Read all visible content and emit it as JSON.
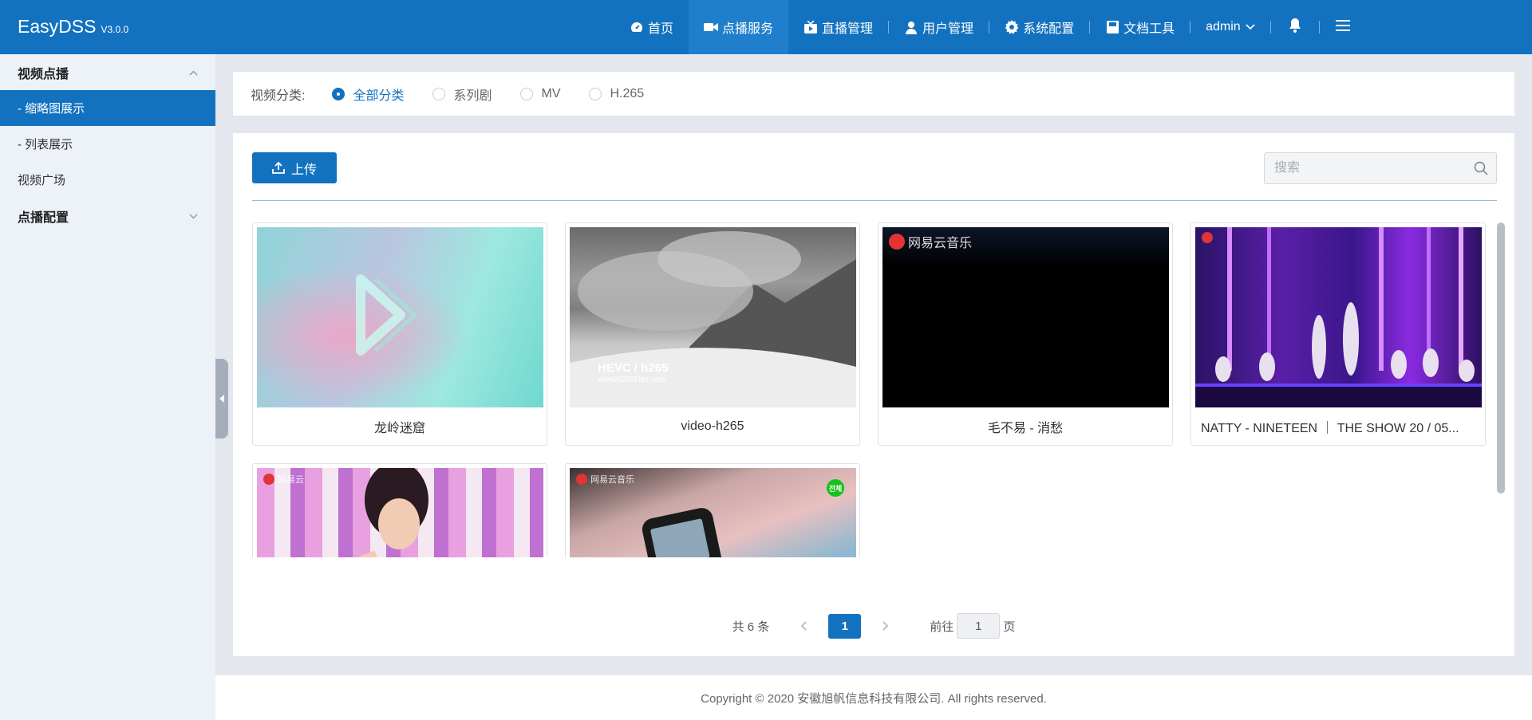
{
  "header": {
    "brand": "EasyDSS",
    "version": "V3.0.0",
    "nav": [
      {
        "label": "首页",
        "icon": "dashboard-icon"
      },
      {
        "label": "点播服务",
        "icon": "video-camera-icon"
      },
      {
        "label": "直播管理",
        "icon": "live-tv-icon"
      },
      {
        "label": "用户管理",
        "icon": "user-icon"
      },
      {
        "label": "系统配置",
        "icon": "gear-icon"
      },
      {
        "label": "文档工具",
        "icon": "document-icon"
      }
    ],
    "user": "admin"
  },
  "sidebar": {
    "groups": [
      {
        "label": "视频点播"
      },
      {
        "label": "点播配置"
      }
    ],
    "items": [
      {
        "label": "- 缩略图展示"
      },
      {
        "label": "- 列表展示"
      },
      {
        "label": "视频广场"
      }
    ]
  },
  "filter": {
    "label": "视频分类:",
    "options": [
      "全部分类",
      "系列剧",
      "MV",
      "H.265"
    ],
    "selected": "全部分类"
  },
  "toolbar": {
    "upload_label": "上传",
    "search_placeholder": "搜索"
  },
  "videos": [
    {
      "title": "龙岭迷窟"
    },
    {
      "title": "video-h265",
      "overlay_text": "HEVC / h265",
      "overlay_sub": "www.h265files.com"
    },
    {
      "title": "毛不易 - 消愁",
      "watermark": "网易云音乐"
    },
    {
      "title": "NATTY - NINETEEN ｜ THE SHOW 20 / 05..."
    },
    {
      "title": "",
      "watermark": "网易云"
    },
    {
      "title": "",
      "watermark": "网易云音乐",
      "badge": "전체"
    }
  ],
  "pagination": {
    "total_text": "共 6 条",
    "current_page": "1",
    "goto_prefix": "前往",
    "goto_value": "1",
    "goto_suffix": "页"
  },
  "footer": {
    "text": "Copyright © 2020 安徽旭帆信息科技有限公司. All rights reserved."
  },
  "colors": {
    "primary": "#1372c0",
    "background": "#e4e7ee",
    "sidebar": "#edf2f8"
  }
}
